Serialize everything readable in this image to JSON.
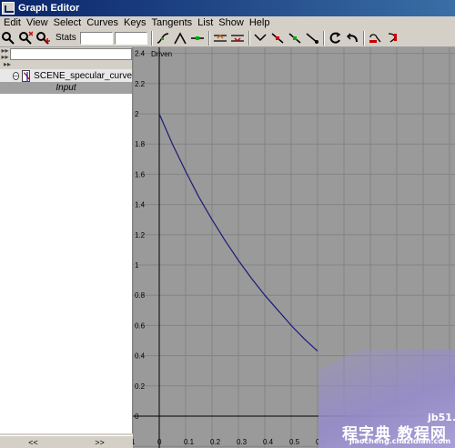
{
  "window": {
    "title": "Graph Editor"
  },
  "menu": [
    "Edit",
    "View",
    "Select",
    "Curves",
    "Keys",
    "Tangents",
    "List",
    "Show",
    "Help"
  ],
  "toolbar": {
    "stats_label": "Stats",
    "stats_value_1": "",
    "stats_value_2": "",
    "left_icons": [
      "move-key-icon",
      "insert-key-icon",
      "add-key-icon"
    ],
    "tangent_icons": [
      "spline-tangent-icon",
      "clamped-tangent-icon",
      "linear-tangent-icon",
      "flat-tangent-icon",
      "step-tangent-icon",
      "plateau-tangent-icon",
      "break-tangent-icon",
      "unify-tangent-icon",
      "lock-weight-icon",
      "free-weight-icon",
      "buffer-curve-icon",
      "swap-buffer-icon",
      "pre-infinity-icon",
      "post-infinity-icon"
    ]
  },
  "outliner": {
    "filter_value": "",
    "node": {
      "label": "SCENE_specular_curve",
      "expanded": true
    },
    "input_label": "Input",
    "scroll_left": "<<",
    "scroll_right": ">>"
  },
  "graph": {
    "attribute_label": "Driven",
    "x_ticks": [
      "1",
      "0",
      "0.1",
      "0.2",
      "0.3",
      "0.4",
      "0.5",
      "0.6"
    ],
    "y_ticks": [
      "0",
      "0.2",
      "0.4",
      "0.6",
      "0.8",
      "1",
      "1.2",
      "1.4",
      "1.6",
      "1.8",
      "2",
      "2.2",
      "2.4"
    ],
    "curve_color": "#1a1a7a",
    "background_color": "#9a9a9a",
    "curve_points": [
      [
        0,
        2.0
      ],
      [
        0.05,
        1.8
      ],
      [
        0.1,
        1.62
      ],
      [
        0.15,
        1.45
      ],
      [
        0.2,
        1.3
      ],
      [
        0.25,
        1.16
      ],
      [
        0.3,
        1.03
      ],
      [
        0.35,
        0.91
      ],
      [
        0.4,
        0.8
      ],
      [
        0.45,
        0.7
      ],
      [
        0.5,
        0.6
      ],
      [
        0.55,
        0.51
      ],
      [
        0.6,
        0.43
      ]
    ]
  },
  "watermark": {
    "site": "jb51.net",
    "cn": "程字典 教程网",
    "url": "jiaocheng.chazidian.com"
  }
}
